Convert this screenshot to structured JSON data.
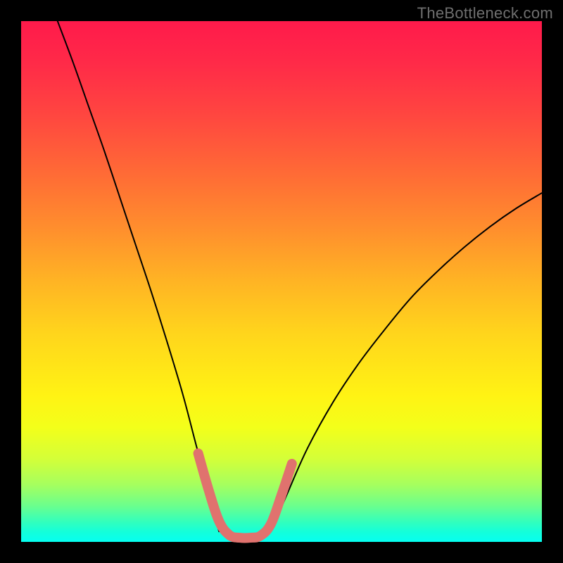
{
  "watermark": "TheBottleneck.com",
  "chart_data": {
    "type": "line",
    "title": "",
    "xlabel": "",
    "ylabel": "",
    "xlim": [
      0,
      100
    ],
    "ylim": [
      0,
      100
    ],
    "grid": false,
    "legend": false,
    "background_gradient": {
      "top": "#ff1a4b",
      "mid": "#fff314",
      "bottom": "#05fff1"
    },
    "series": [
      {
        "name": "left-branch",
        "style": "black-thin",
        "x": [
          7,
          10,
          13,
          16,
          19,
          22,
          25,
          28,
          31,
          33.5,
          36,
          38
        ],
        "values": [
          100,
          92,
          83.5,
          75,
          66,
          57,
          48,
          38.5,
          28.5,
          19,
          9.5,
          2
        ]
      },
      {
        "name": "right-branch",
        "style": "black-thin",
        "x": [
          48,
          51,
          55,
          60,
          65,
          70,
          75,
          80,
          85,
          90,
          95,
          100
        ],
        "values": [
          2,
          9,
          18,
          27,
          34.5,
          41,
          47,
          52,
          56.5,
          60.5,
          64,
          67
        ]
      },
      {
        "name": "bottom-highlight",
        "style": "salmon-thick",
        "x": [
          34,
          36,
          38,
          40,
          42,
          44,
          46,
          48,
          50,
          52
        ],
        "values": [
          17,
          10,
          4,
          1.3,
          0.8,
          0.8,
          1.2,
          3.5,
          9,
          15
        ]
      }
    ],
    "annotations": []
  }
}
